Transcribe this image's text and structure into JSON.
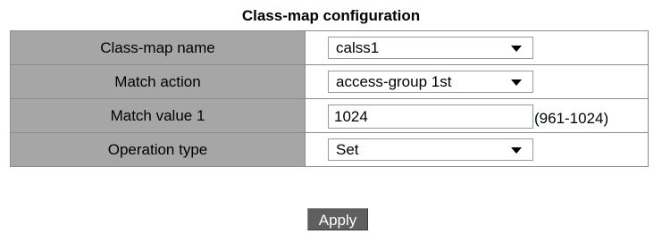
{
  "page": {
    "title": "Class-map configuration"
  },
  "form": {
    "rows": [
      {
        "label": "Class-map name",
        "type": "select",
        "value": "calss1"
      },
      {
        "label": "Match action",
        "type": "select",
        "value": "access-group 1st"
      },
      {
        "label": "Match value 1",
        "type": "input",
        "value": "1024",
        "hint": "(961-1024)"
      },
      {
        "label": "Operation type",
        "type": "select",
        "value": "Set"
      }
    ]
  },
  "actions": {
    "apply_label": "Apply"
  },
  "colors": {
    "label_bg": "#a6a6a6",
    "button_bg": "#5f5f5f",
    "border": "#8c8c8c"
  },
  "icons": {
    "dropdown": "chevron-down-icon"
  }
}
